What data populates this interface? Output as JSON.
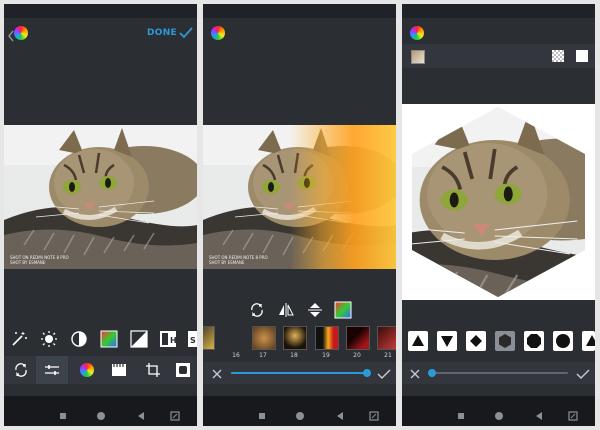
{
  "panel1": {
    "done_label": "DONE",
    "watermark_line1": "SHOT ON REDMI NOTE 8 PRO",
    "watermark_line2": "SHOT BY ESMANE"
  },
  "panel2": {
    "filter_numbers": [
      "16",
      "17",
      "18",
      "19",
      "20",
      "21"
    ],
    "watermark_line1": "SHOT ON REDMI NOTE 8 PRO",
    "watermark_line2": "SHOT BY ESMANE",
    "slider_value": 0.98
  },
  "panel3": {
    "slider_value": 0.0
  },
  "colors": {
    "accent": "#2c9ad6",
    "background": "#2b2e33"
  }
}
